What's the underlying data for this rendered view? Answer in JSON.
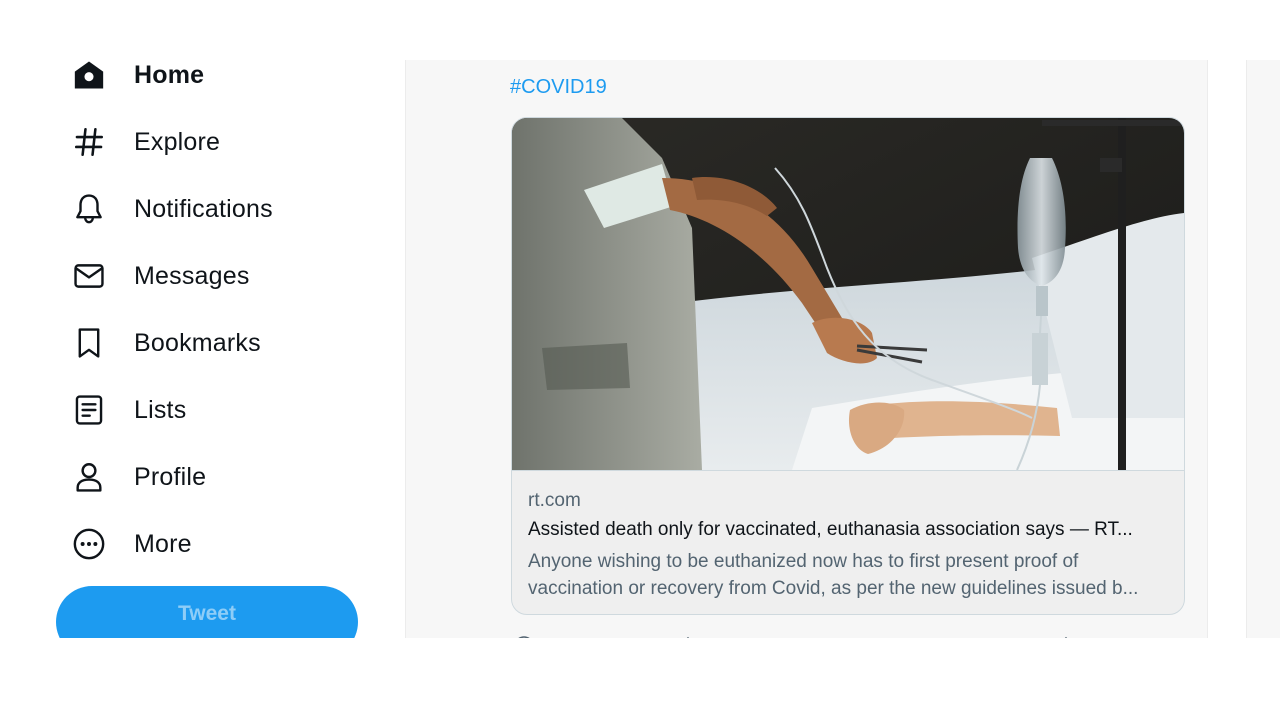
{
  "sidebar": {
    "items": [
      {
        "label": "Home",
        "icon": "home-icon",
        "active": true
      },
      {
        "label": "Explore",
        "icon": "hashtag-icon"
      },
      {
        "label": "Notifications",
        "icon": "bell-icon"
      },
      {
        "label": "Messages",
        "icon": "envelope-icon"
      },
      {
        "label": "Bookmarks",
        "icon": "bookmark-icon"
      },
      {
        "label": "Lists",
        "icon": "list-icon"
      },
      {
        "label": "Profile",
        "icon": "person-icon"
      },
      {
        "label": "More",
        "icon": "more-circle-icon"
      }
    ],
    "tweet_button": "Tweet"
  },
  "tweet": {
    "hashtag": "#COVID19",
    "card": {
      "image": "photo of a medical worker adjusting an IV drip beside a patient in a hospital bed",
      "domain": "rt.com",
      "title": "Assisted death only for vaccinated, euthanasia association says — RT...",
      "description_line1": "Anyone wishing to be euthanized now has to first present proof of",
      "description_line2": "vaccination or recovery from Covid, as per the new guidelines issued b..."
    },
    "actions": [
      "reply-icon",
      "retweet-icon",
      "like-icon",
      "share-icon"
    ]
  },
  "colors": {
    "accent": "#1d9bf0",
    "text": "#0f1419",
    "secondary_text": "#536471",
    "border": "#cfd9de"
  }
}
